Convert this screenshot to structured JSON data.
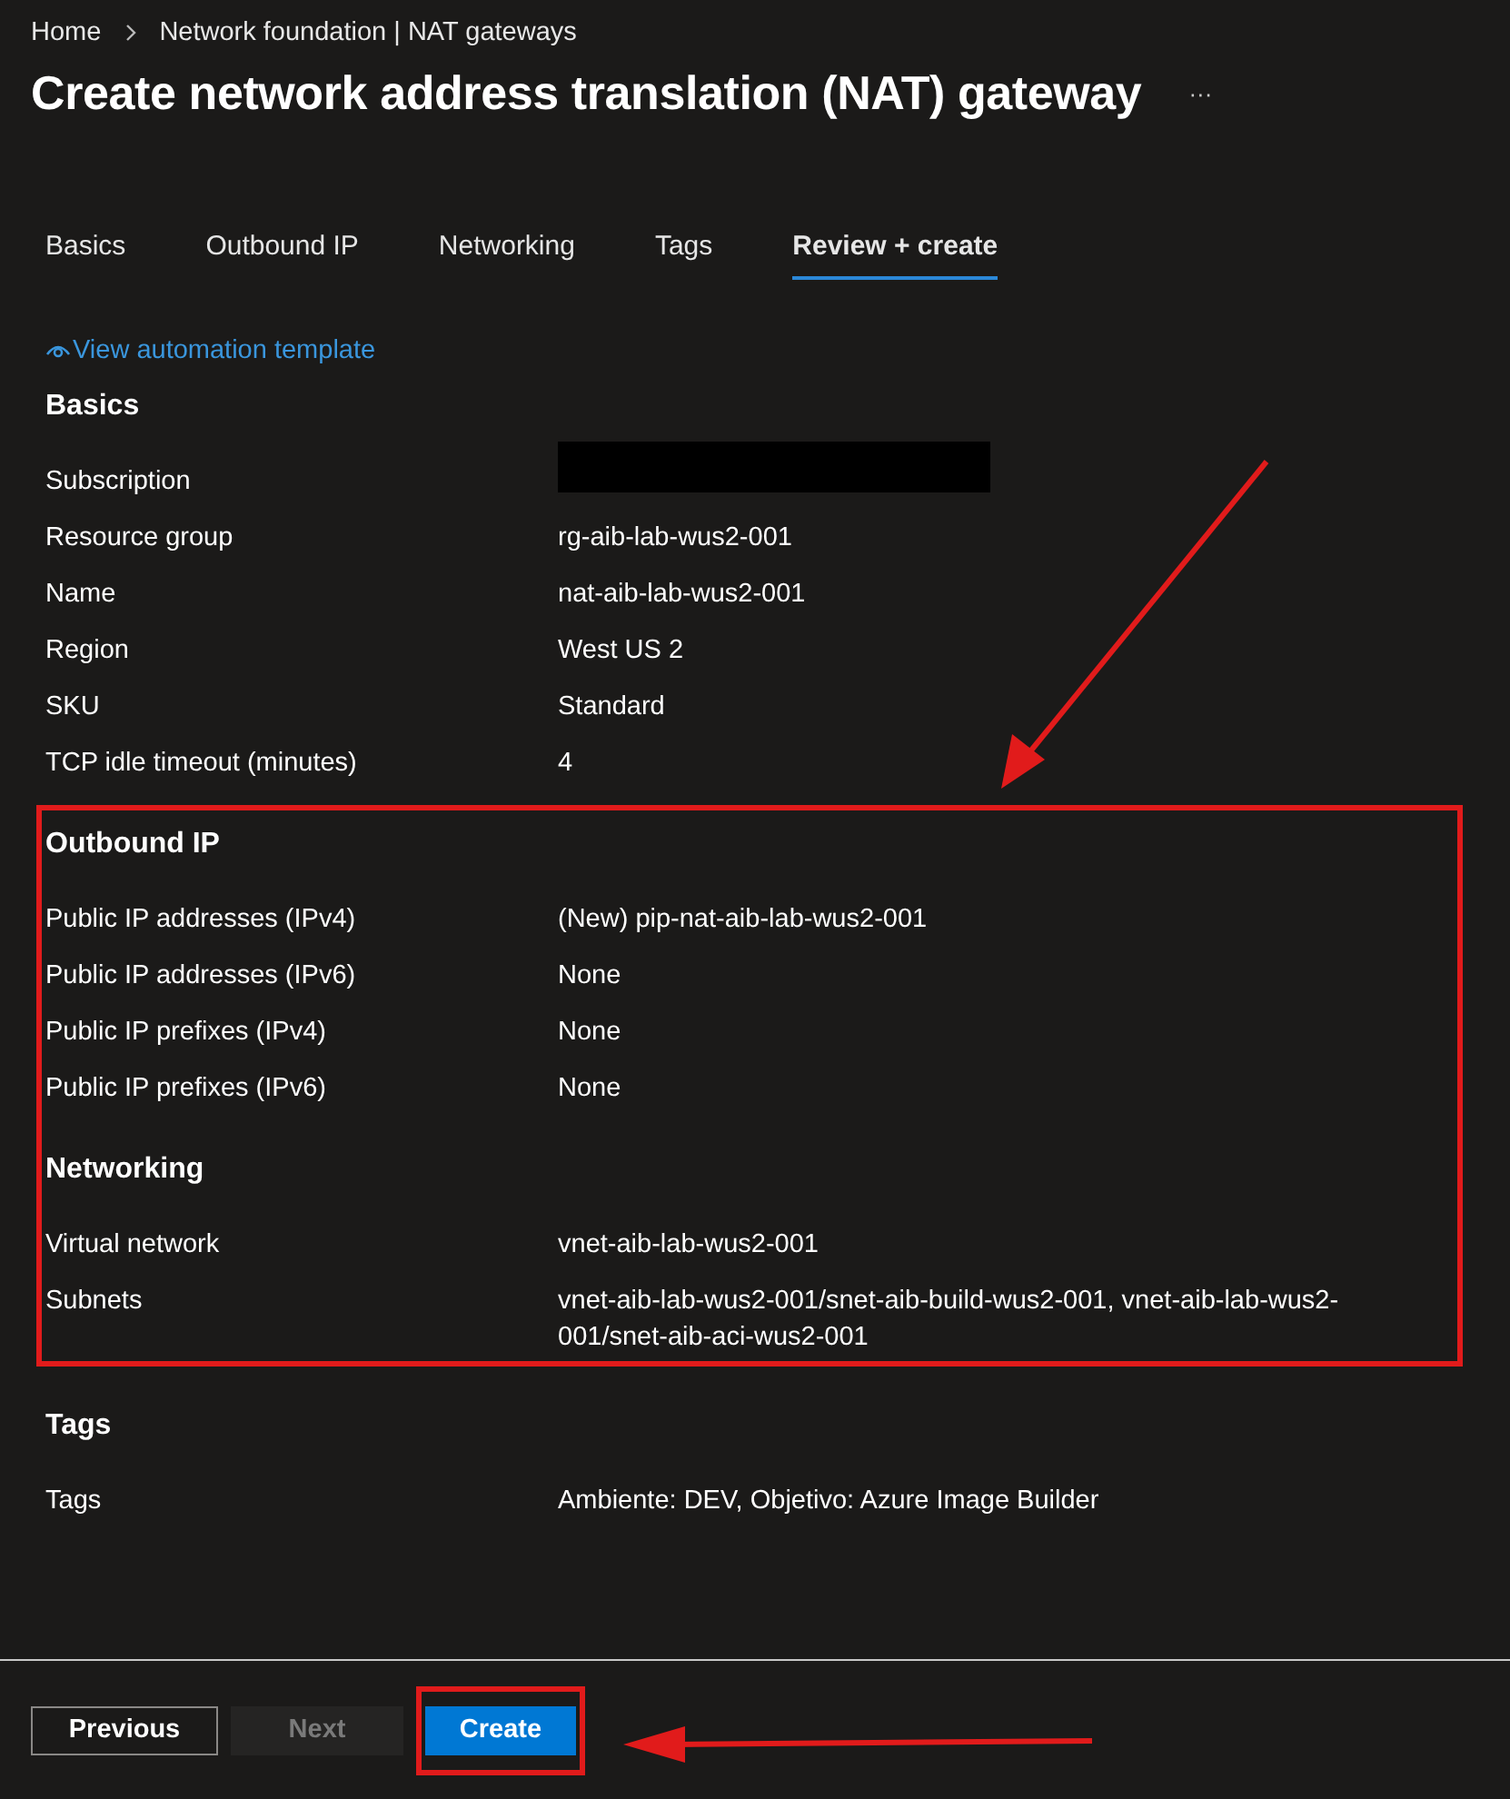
{
  "breadcrumb": [
    "Home",
    "Network foundation | NAT gateways"
  ],
  "title": "Create network address translation (NAT) gateway",
  "more_label": "···",
  "tabs": [
    {
      "label": "Basics",
      "selected": false
    },
    {
      "label": "Outbound IP",
      "selected": false
    },
    {
      "label": "Networking",
      "selected": false
    },
    {
      "label": "Tags",
      "selected": false
    },
    {
      "label": "Review + create",
      "selected": true
    }
  ],
  "automation_link": "View automation template",
  "sections": [
    {
      "title": "Basics",
      "highlighted": false,
      "rows": [
        {
          "label": "Subscription",
          "value": "",
          "redacted": true
        },
        {
          "label": "Resource group",
          "value": "rg-aib-lab-wus2-001",
          "redacted": false
        },
        {
          "label": "Name",
          "value": "nat-aib-lab-wus2-001",
          "redacted": false
        },
        {
          "label": "Region",
          "value": "West US 2",
          "redacted": false
        },
        {
          "label": "SKU",
          "value": "Standard",
          "redacted": false
        },
        {
          "label": "TCP idle timeout (minutes)",
          "value": "4",
          "redacted": false
        }
      ]
    },
    {
      "title": "Outbound IP",
      "highlighted": true,
      "rows": [
        {
          "label": "Public IP addresses (IPv4)",
          "value": "(New) pip-nat-aib-lab-wus2-001",
          "redacted": false
        },
        {
          "label": "Public IP addresses (IPv6)",
          "value": "None",
          "redacted": false
        },
        {
          "label": "Public IP prefixes (IPv4)",
          "value": "None",
          "redacted": false
        },
        {
          "label": "Public IP prefixes (IPv6)",
          "value": "None",
          "redacted": false
        }
      ]
    },
    {
      "title": "Networking",
      "highlighted": true,
      "rows": [
        {
          "label": "Virtual network",
          "value": "vnet-aib-lab-wus2-001",
          "redacted": false
        },
        {
          "label": "Subnets",
          "value": "vnet-aib-lab-wus2-001/snet-aib-build-wus2-001, vnet-aib-lab-wus2-001/snet-aib-aci-wus2-001",
          "redacted": false
        }
      ]
    },
    {
      "title": "Tags",
      "highlighted": false,
      "rows": [
        {
          "label": "Tags",
          "value": "Ambiente: DEV, Objetivo: Azure Image Builder",
          "redacted": false
        }
      ]
    }
  ],
  "footer_buttons": [
    {
      "label": "Previous",
      "kind": "secondary",
      "disabled": false,
      "highlighted": false
    },
    {
      "label": "Next",
      "kind": "secondary",
      "disabled": true,
      "highlighted": false
    },
    {
      "label": "Create",
      "kind": "primary",
      "disabled": false,
      "highlighted": true
    }
  ]
}
